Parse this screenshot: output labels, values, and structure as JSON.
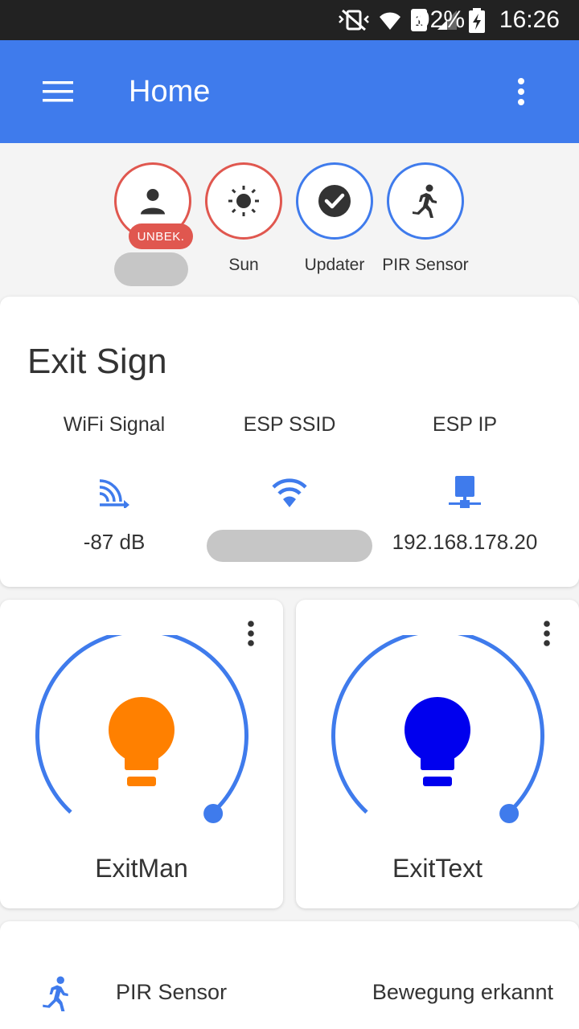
{
  "statusbar": {
    "battery": "92%",
    "time": "16:26",
    "sim": "1"
  },
  "appbar": {
    "title": "Home",
    "menu_icon": "menu-icon",
    "overflow_icon": "more-vert-icon"
  },
  "badges": [
    {
      "label": "",
      "state": "UNBEK.",
      "icon": "person-icon",
      "color": "#e0574f"
    },
    {
      "label": "Sun",
      "icon": "sun-icon",
      "color": "#e0574f"
    },
    {
      "label": "Updater",
      "icon": "check-circle-icon",
      "color": "#3f7bec"
    },
    {
      "label": "PIR Sensor",
      "icon": "run-icon",
      "color": "#3f7bec"
    }
  ],
  "exit_sign": {
    "title": "Exit Sign",
    "attributes": [
      {
        "name": "WiFi Signal",
        "value": "-87 dB",
        "icon": "signal-distance-icon"
      },
      {
        "name": "ESP SSID",
        "value": "",
        "icon": "wifi-icon"
      },
      {
        "name": "ESP IP",
        "value": "192.168.178.20",
        "icon": "lan-icon"
      }
    ]
  },
  "lights": [
    {
      "name": "ExitMan",
      "bulb_color": "#ff8000",
      "brightness_fraction": 1.0
    },
    {
      "name": "ExitText",
      "bulb_color": "#0000ee",
      "brightness_fraction": 1.0
    }
  ],
  "pir": {
    "name": "PIR Sensor",
    "state": "Bewegung erkannt",
    "icon": "run-icon"
  },
  "colors": {
    "accent": "#3f7bec",
    "unknown": "#e0574f",
    "statusbar": "#222222"
  }
}
